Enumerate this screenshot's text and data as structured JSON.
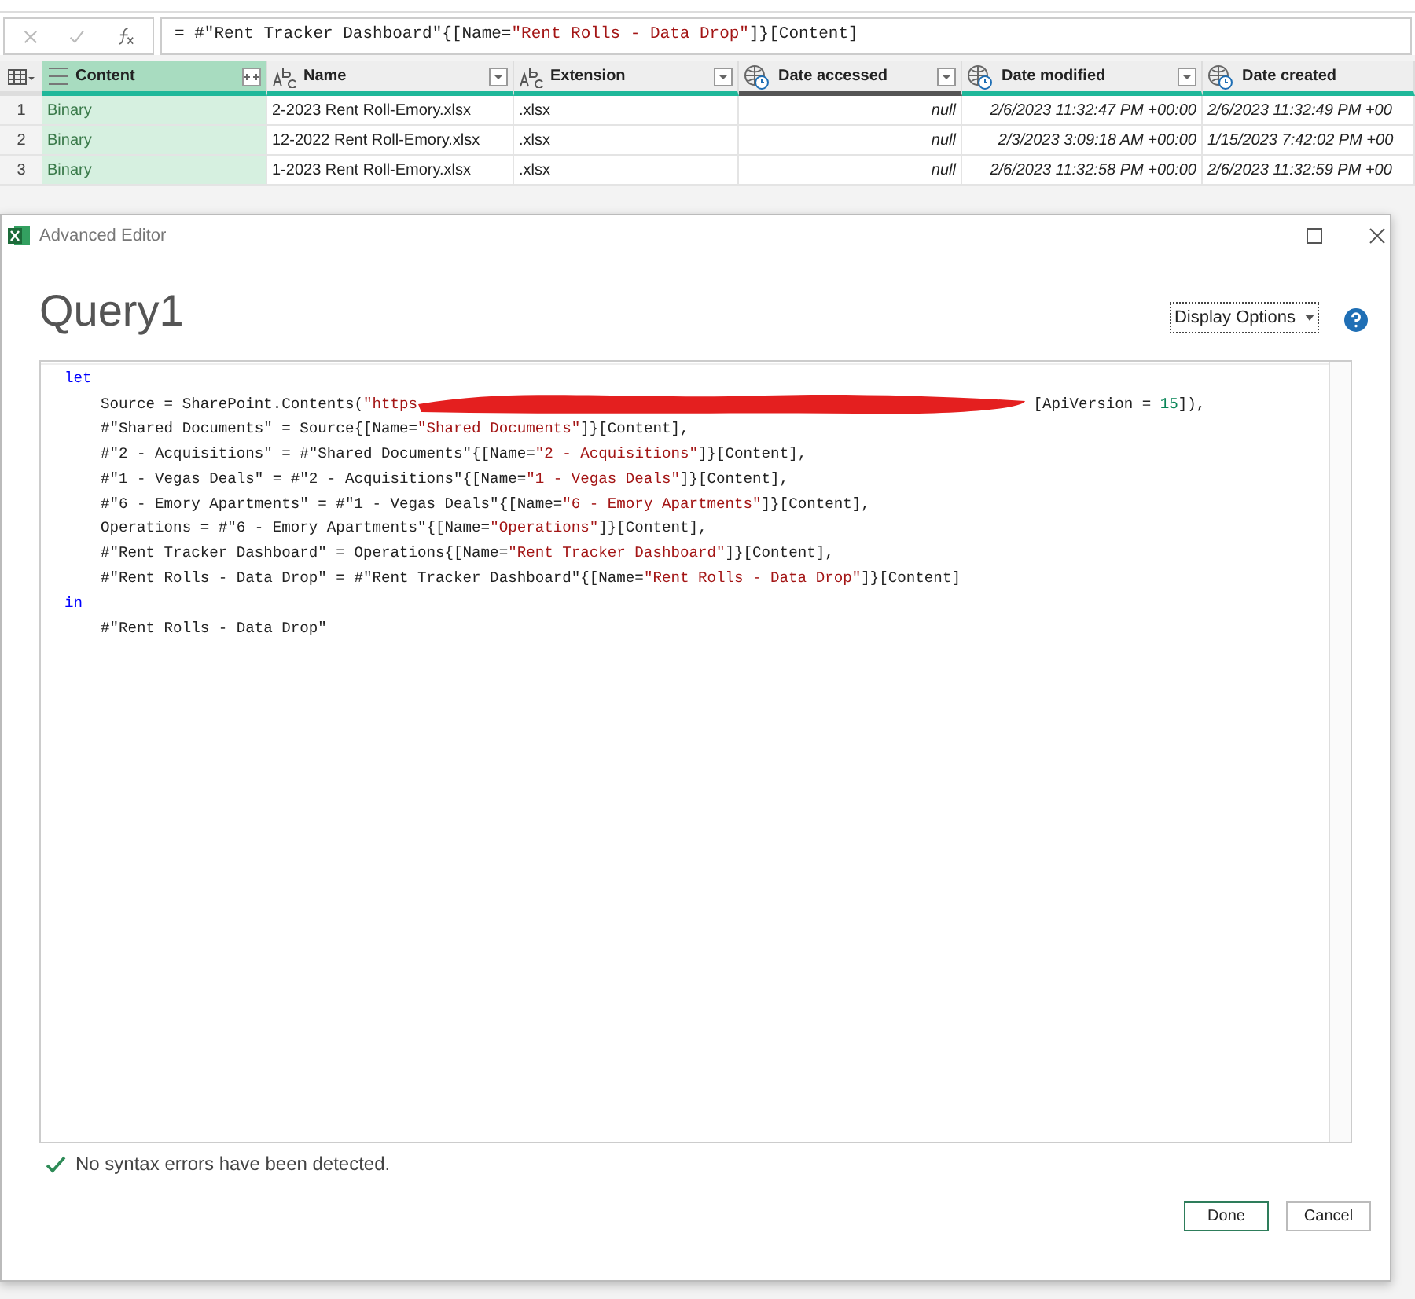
{
  "formula_bar": {
    "segments": [
      {
        "kind": "plain",
        "text": "= #\"Rent Tracker Dashboard\"{[Name="
      },
      {
        "kind": "string",
        "text": "\"Rent Rolls - Data Drop\""
      },
      {
        "kind": "plain",
        "text": "]}[Content]"
      }
    ]
  },
  "table": {
    "columns": [
      {
        "label": "Content",
        "kind": "binary",
        "selected": true,
        "all_null": false,
        "expandable": true
      },
      {
        "label": "Name",
        "kind": "text",
        "selected": false,
        "all_null": false,
        "expandable": false
      },
      {
        "label": "Extension",
        "kind": "text",
        "selected": false,
        "all_null": false,
        "expandable": false
      },
      {
        "label": "Date accessed",
        "kind": "datetime",
        "selected": false,
        "all_null": true,
        "expandable": false
      },
      {
        "label": "Date modified",
        "kind": "datetime",
        "selected": false,
        "all_null": false,
        "expandable": false
      },
      {
        "label": "Date created",
        "kind": "datetime",
        "selected": false,
        "all_null": false
      }
    ],
    "rows": [
      {
        "number": "1",
        "cells": [
          "Binary",
          "2-2023 Rent Roll-Emory.xlsx",
          ".xlsx",
          "null",
          "2/6/2023 11:32:47 PM +00:00",
          "2/6/2023 11:32:49 PM +00"
        ]
      },
      {
        "number": "2",
        "cells": [
          "Binary",
          "12-2022 Rent Roll-Emory.xlsx",
          ".xlsx",
          "null",
          "2/3/2023 3:09:18 AM +00:00",
          "1/15/2023 7:42:02 PM +00"
        ]
      },
      {
        "number": "3",
        "cells": [
          "Binary",
          "1-2023 Rent Roll-Emory.xlsx",
          ".xlsx",
          "null",
          "2/6/2023 11:32:58 PM +00:00",
          "2/6/2023 11:32:59 PM +00"
        ]
      }
    ]
  },
  "dialog": {
    "title": "Advanced Editor",
    "query_name": "Query1",
    "display_options": "Display Options",
    "code_lines": [
      {
        "indent": false,
        "segments": [
          {
            "kind": "keyword",
            "text": "let"
          }
        ]
      },
      {
        "indent": true,
        "segments": [
          {
            "kind": "plain",
            "text": "Source = SharePoint.Contents("
          },
          {
            "kind": "string",
            "text": "\"https"
          },
          {
            "kind": "redaction"
          },
          {
            "kind": "plain",
            "text": " [ApiVersion = "
          },
          {
            "kind": "number",
            "text": "15"
          },
          {
            "kind": "plain",
            "text": "]),"
          }
        ]
      },
      {
        "indent": true,
        "segments": [
          {
            "kind": "plain",
            "text": "#\"Shared Documents\" = Source{[Name="
          },
          {
            "kind": "string",
            "text": "\"Shared Documents\""
          },
          {
            "kind": "plain",
            "text": "]}[Content],"
          }
        ]
      },
      {
        "indent": true,
        "segments": [
          {
            "kind": "plain",
            "text": "#\"2 - Acquisitions\" = #\"Shared Documents\"{[Name="
          },
          {
            "kind": "string",
            "text": "\"2 - Acquisitions\""
          },
          {
            "kind": "plain",
            "text": "]}[Content],"
          }
        ]
      },
      {
        "indent": true,
        "segments": [
          {
            "kind": "plain",
            "text": "#\"1 - Vegas Deals\" = #\"2 - Acquisitions\"{[Name="
          },
          {
            "kind": "string",
            "text": "\"1 - Vegas Deals\""
          },
          {
            "kind": "plain",
            "text": "]}[Content],"
          }
        ]
      },
      {
        "indent": true,
        "segments": [
          {
            "kind": "plain",
            "text": "#\"6 - Emory Apartments\" = #\"1 - Vegas Deals\"{[Name="
          },
          {
            "kind": "string",
            "text": "\"6 - Emory Apartments\""
          },
          {
            "kind": "plain",
            "text": "]}[Content],"
          }
        ]
      },
      {
        "indent": true,
        "segments": [
          {
            "kind": "plain",
            "text": "Operations = #\"6 - Emory Apartments\"{[Name="
          },
          {
            "kind": "string",
            "text": "\"Operations\""
          },
          {
            "kind": "plain",
            "text": "]}[Content],"
          }
        ]
      },
      {
        "indent": true,
        "segments": [
          {
            "kind": "plain",
            "text": "#\"Rent Tracker Dashboard\" = Operations{[Name="
          },
          {
            "kind": "string",
            "text": "\"Rent Tracker Dashboard\""
          },
          {
            "kind": "plain",
            "text": "]}[Content],"
          }
        ]
      },
      {
        "indent": true,
        "segments": [
          {
            "kind": "plain",
            "text": "#\"Rent Rolls - Data Drop\" = #\"Rent Tracker Dashboard\"{[Name="
          },
          {
            "kind": "string",
            "text": "\"Rent Rolls - Data Drop\""
          },
          {
            "kind": "plain",
            "text": "]}[Content]"
          }
        ]
      },
      {
        "indent": false,
        "segments": [
          {
            "kind": "keyword",
            "text": "in"
          }
        ]
      },
      {
        "indent": true,
        "segments": [
          {
            "kind": "plain",
            "text": "#\"Rent Rolls - Data Drop\""
          }
        ]
      }
    ],
    "status": {
      "ok": true,
      "text": "No syntax errors have been detected."
    },
    "buttons": [
      {
        "label": "Done",
        "primary": true
      },
      {
        "label": "Cancel",
        "primary": false
      }
    ]
  }
}
